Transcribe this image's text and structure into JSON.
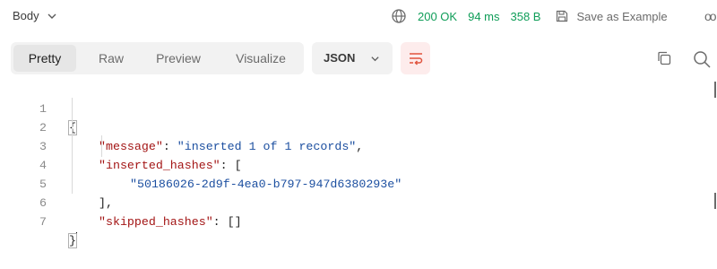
{
  "topbar": {
    "body_label": "Body",
    "status": "200 OK",
    "time": "94 ms",
    "size": "358 B",
    "save_label": "Save as Example",
    "more": "oo"
  },
  "toolbar": {
    "tabs": [
      {
        "label": "Pretty",
        "active": true
      },
      {
        "label": "Raw",
        "active": false
      },
      {
        "label": "Preview",
        "active": false
      },
      {
        "label": "Visualize",
        "active": false
      }
    ],
    "format": "JSON"
  },
  "editor": {
    "lines": [
      {
        "n": "1"
      },
      {
        "n": "2",
        "key": "\"message\"",
        "sep": ": ",
        "val": "\"inserted 1 of 1 records\"",
        "tail": ","
      },
      {
        "n": "3",
        "key": "\"inserted_hashes\"",
        "sep": ": ",
        "tail": "["
      },
      {
        "n": "4",
        "val": "\"50186026-2d9f-4ea0-b797-947d6380293e\""
      },
      {
        "n": "5",
        "tail": "],"
      },
      {
        "n": "6",
        "key": "\"skipped_hashes\"",
        "sep": ": ",
        "tail": "[]"
      },
      {
        "n": "7"
      }
    ],
    "open_brace": "{",
    "close_brace": "}"
  },
  "colors": {
    "status_green": "#0f9d58",
    "key_red": "#a31515",
    "string_blue": "#1c4fa0",
    "wrap_accent": "#e0533d"
  }
}
